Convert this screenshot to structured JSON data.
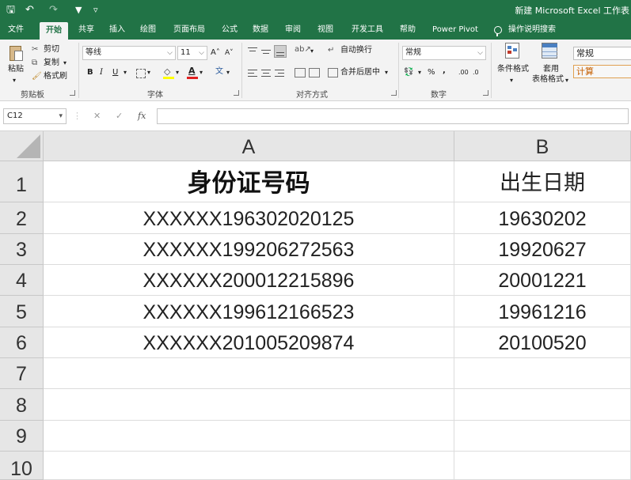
{
  "window": {
    "title": "新建 Microsoft Excel 工作表"
  },
  "quick_access": [
    {
      "icon": "save-icon",
      "glyph": "🖫"
    },
    {
      "icon": "undo-icon",
      "glyph": "↶"
    },
    {
      "icon": "redo-icon",
      "glyph": "↷"
    },
    {
      "icon": "filter-icon",
      "glyph": "▼"
    },
    {
      "icon": "customize-icon",
      "glyph": "▿"
    }
  ],
  "tabs": [
    "文件",
    "开始",
    "共享",
    "插入",
    "绘图",
    "页面布局",
    "公式",
    "数据",
    "审阅",
    "视图",
    "开发工具",
    "帮助",
    "Power Pivot"
  ],
  "active_tab": "开始",
  "tell_me": "操作说明搜索",
  "ribbon": {
    "clipboard": {
      "paste": "粘贴",
      "cut": "剪切",
      "copy": "复制",
      "format_painter": "格式刷",
      "label": "剪贴板"
    },
    "font": {
      "name": "等线",
      "size": "11",
      "increase": "A˄",
      "decrease": "A˅",
      "bold": "B",
      "italic": "I",
      "underline": "U",
      "phonetic": "文",
      "label": "字体"
    },
    "alignment": {
      "wrap_text": "自动换行",
      "merge_center": "合并后居中",
      "label": "对齐方式"
    },
    "number": {
      "format": "常规",
      "percent": "%",
      "comma": ",",
      "increase_decimal": ".00",
      "decrease_decimal": ".0",
      "label": "数字"
    },
    "styles": {
      "conditional": "条件格式",
      "table_format_top": "套用",
      "table_format_bottom": "表格格式",
      "normal": "常规",
      "calc": "计算"
    }
  },
  "formula_bar": {
    "name_box": "C12",
    "cancel": "✕",
    "enter": "✓",
    "fx": "fx",
    "content": ""
  },
  "sheet": {
    "columns": [
      "A",
      "B"
    ],
    "row_numbers": [
      "1",
      "2",
      "3",
      "4",
      "5",
      "6",
      "7",
      "8",
      "9",
      "10"
    ],
    "header": [
      "身份证号码",
      "出生日期"
    ],
    "rows": [
      [
        "XXXXXX196302020125",
        "19630202"
      ],
      [
        "XXXXXX199206272563",
        "19920627"
      ],
      [
        "XXXXXX200012215896",
        "20001221"
      ],
      [
        "XXXXXX199612166523",
        "19961216"
      ],
      [
        "XXXXXX201005209874",
        "20100520"
      ]
    ]
  },
  "colors": {
    "accent": "#217346"
  }
}
